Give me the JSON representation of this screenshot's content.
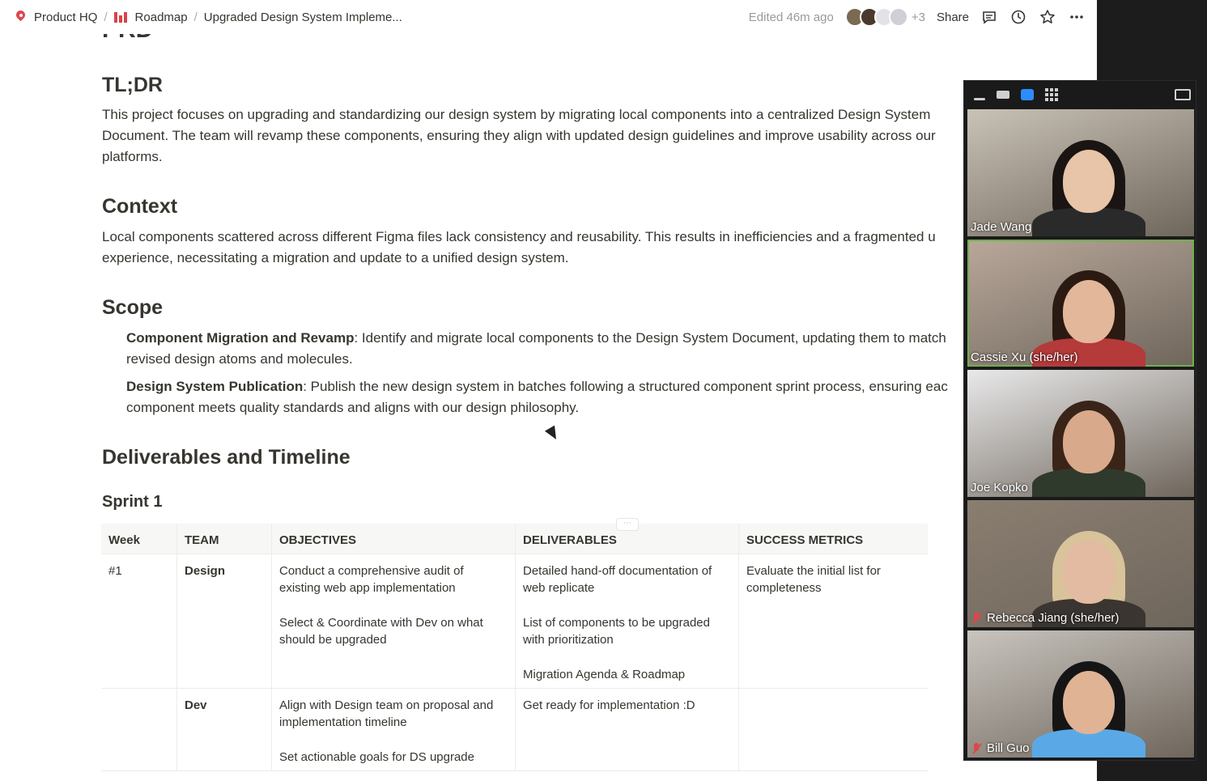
{
  "breadcrumb": {
    "workspace": "Product HQ",
    "section": "Roadmap",
    "page": "Upgraded Design System Impleme..."
  },
  "topbar": {
    "edited": "Edited 46m ago",
    "extra_count": "+3",
    "share": "Share"
  },
  "doc": {
    "sections": {
      "tldr_title": "TL;DR",
      "tldr_text_1": "This project focuses on upgrading and standardizing our design system by migrating local components into a centralized Design System",
      "tldr_text_2": "Document. The team will revamp these components, ensuring they align with updated design guidelines and improve usability across our",
      "tldr_text_3": "platforms.",
      "context_title": "Context",
      "context_text_1": "Local components scattered across different Figma files lack consistency and reusability. This results in inefficiencies and a fragmented u",
      "context_text_2": "experience, necessitating a migration and update to a unified design system.",
      "scope_title": "Scope",
      "scope_items": [
        {
          "bold": "Component Migration and Revamp",
          "line1": ": Identify and migrate local components to the Design System Document, updating them to match",
          "line2": "revised design atoms and molecules."
        },
        {
          "bold": "Design System Publication",
          "line1": ": Publish the new design system in batches following a structured component sprint process, ensuring eac",
          "line2": "component meets quality standards and aligns with our design philosophy."
        }
      ],
      "deliverables_title": "Deliverables and Timeline",
      "sprint_title": "Sprint 1"
    },
    "table": {
      "headers": [
        "Week",
        "TEAM",
        "OBJECTIVES",
        "DELIVERABLES",
        "SUCCESS METRICS"
      ],
      "rows": [
        {
          "week": "#1",
          "team": "Design",
          "objectives": [
            "Conduct a comprehensive audit of existing web app implementation",
            "Select & Coordinate with Dev on what should be upgraded"
          ],
          "deliverables": [
            "Detailed hand-off documentation of web replicate",
            "List of components to be upgraded with prioritization",
            "Migration Agenda & Roadmap"
          ],
          "metrics": [
            "Evaluate the initial list for completeness"
          ]
        },
        {
          "week": "",
          "team": "Dev",
          "objectives": [
            "Align with Design team on proposal and implementation timeline",
            "Set actionable goals for DS upgrade"
          ],
          "deliverables": [
            "Get ready for implementation :D"
          ],
          "metrics": []
        }
      ]
    }
  },
  "call": {
    "participants": [
      {
        "name": "Jade Wang",
        "muted": false,
        "bg": "#c9c2b6",
        "skin": "#e8c4a8",
        "hair": "#1a1412",
        "shirt": "#2a2a2a"
      },
      {
        "name": "Cassie Xu (she/her)",
        "muted": false,
        "active": true,
        "bg": "#b9a89a",
        "skin": "#e3b79a",
        "hair": "#2a1a12",
        "shirt": "#b53a3a"
      },
      {
        "name": "Joe Kopko",
        "muted": false,
        "bg": "#e9e9ea",
        "skin": "#d8a98a",
        "hair": "#3a2418",
        "shirt": "#2f3a2c"
      },
      {
        "name": "Rebecca Jiang (she/her)",
        "muted": true,
        "bg": "#8a7e70",
        "skin": "#e2bba2",
        "hair": "#d8c39a",
        "shirt": "#3a3530"
      },
      {
        "name": "Bill Guo",
        "muted": true,
        "bg": "#c8c4be",
        "skin": "#e0b394",
        "hair": "#151515",
        "shirt": "#5aa9e6"
      }
    ]
  },
  "colors": {
    "accent_red": "#e0454b",
    "speaker_active": "#2d8cff",
    "active_outline": "#6fb04b"
  }
}
